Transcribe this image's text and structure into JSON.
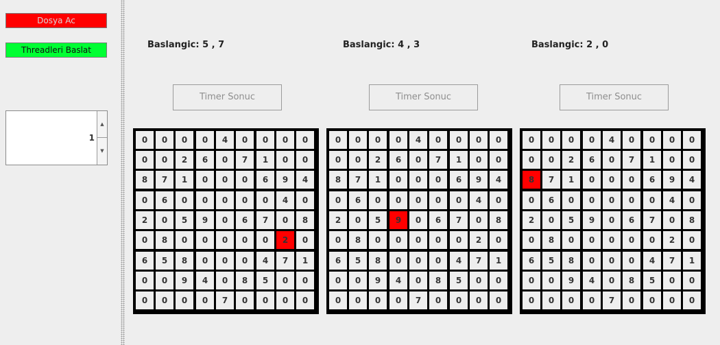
{
  "controls": {
    "open_label": "Dosya Ac",
    "start_label": "Threadleri Baslat",
    "spinner_value": "1",
    "open_color": "#ff0000",
    "start_color": "#00ff33"
  },
  "board": [
    [
      0,
      0,
      0,
      0,
      4,
      0,
      0,
      0,
      0
    ],
    [
      0,
      0,
      2,
      6,
      0,
      7,
      1,
      0,
      0
    ],
    [
      8,
      7,
      1,
      0,
      0,
      0,
      6,
      9,
      4
    ],
    [
      0,
      6,
      0,
      0,
      0,
      0,
      0,
      4,
      0
    ],
    [
      2,
      0,
      5,
      9,
      0,
      6,
      7,
      0,
      8
    ],
    [
      0,
      8,
      0,
      0,
      0,
      0,
      0,
      2,
      0
    ],
    [
      6,
      5,
      8,
      0,
      0,
      0,
      4,
      7,
      1
    ],
    [
      0,
      0,
      9,
      4,
      0,
      8,
      5,
      0,
      0
    ],
    [
      0,
      0,
      0,
      0,
      7,
      0,
      0,
      0,
      0
    ]
  ],
  "panels": [
    {
      "start_label": "Baslangic: 5 , 7",
      "timer_label": "Timer Sonuc",
      "highlight": {
        "row": 5,
        "col": 7
      }
    },
    {
      "start_label": "Baslangic: 4 , 3",
      "timer_label": "Timer Sonuc",
      "highlight": {
        "row": 4,
        "col": 3
      }
    },
    {
      "start_label": "Baslangic: 2 , 0",
      "timer_label": "Timer Sonuc",
      "highlight": {
        "row": 2,
        "col": 0
      }
    }
  ],
  "highlight_color": "#ff0000"
}
